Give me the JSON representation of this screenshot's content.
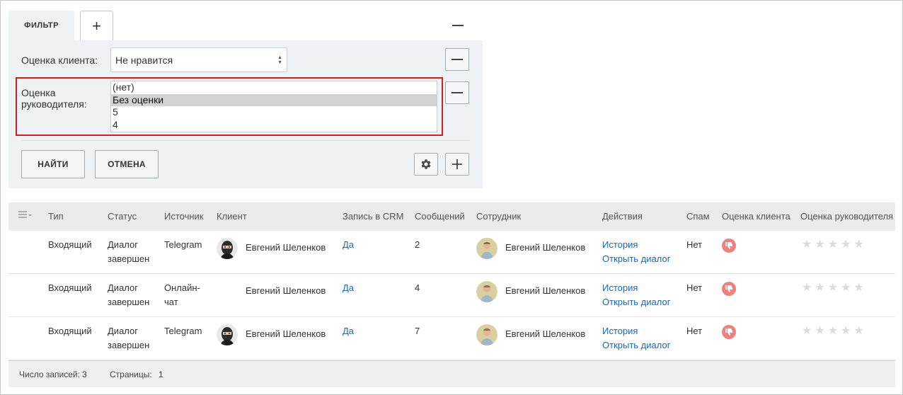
{
  "filter": {
    "tab_label": "ФИЛЬТР",
    "add_tab_label": "+",
    "client_rating": {
      "label": "Оценка клиента:",
      "value": "Не нравится"
    },
    "manager_rating": {
      "label_line1": "Оценка",
      "label_line2": "руководителя:",
      "options": [
        "(нет)",
        "Без оценки",
        "5",
        "4"
      ],
      "selected": "Без оценки"
    },
    "find_button": "НАЙТИ",
    "cancel_button": "ОТМЕНА"
  },
  "table": {
    "columns": [
      "Тип",
      "Статус",
      "Источник",
      "Клиент",
      "Запись в CRM",
      "Сообщений",
      "Сотрудник",
      "Действия",
      "Спам",
      "Оценка клиента",
      "Оценка руководителя"
    ],
    "rows": [
      {
        "type": "Входящий",
        "status_1": "Диалог",
        "status_2": "завершен",
        "source_1": "Telegram",
        "source_2": "",
        "client": "Евгений Шеленков",
        "client_avatar": "masked-person",
        "crm": "Да",
        "messages": "2",
        "employee": "Евгений Шеленков",
        "action_history": "История",
        "action_open": "Открыть диалог",
        "spam": "Нет",
        "client_rating": "dislike",
        "manager_rating": 0
      },
      {
        "type": "Входящий",
        "status_1": "Диалог",
        "status_2": "завершен",
        "source_1": "Онлайн-",
        "source_2": "чат",
        "client": "Евгений Шеленков",
        "client_avatar": "none",
        "crm": "Да",
        "messages": "4",
        "employee": "Евгений Шеленков",
        "action_history": "История",
        "action_open": "Открыть диалог",
        "spam": "Нет",
        "client_rating": "dislike",
        "manager_rating": 0
      },
      {
        "type": "Входящий",
        "status_1": "Диалог",
        "status_2": "завершен",
        "source_1": "Telegram",
        "source_2": "",
        "client": "Евгений Шеленков",
        "client_avatar": "masked-person",
        "crm": "Да",
        "messages": "7",
        "employee": "Евгений Шеленков",
        "action_history": "История",
        "action_open": "Открыть диалог",
        "spam": "Нет",
        "client_rating": "dislike",
        "manager_rating": 0
      }
    ],
    "footer": {
      "records_label": "Число записей:",
      "records_count": "3",
      "pages_label": "Страницы:",
      "pages_value": "1"
    }
  },
  "colors": {
    "highlight": "#d21e1e",
    "link": "#2067b0",
    "dislike": "#f07f7f",
    "panel": "#eef2f4"
  }
}
